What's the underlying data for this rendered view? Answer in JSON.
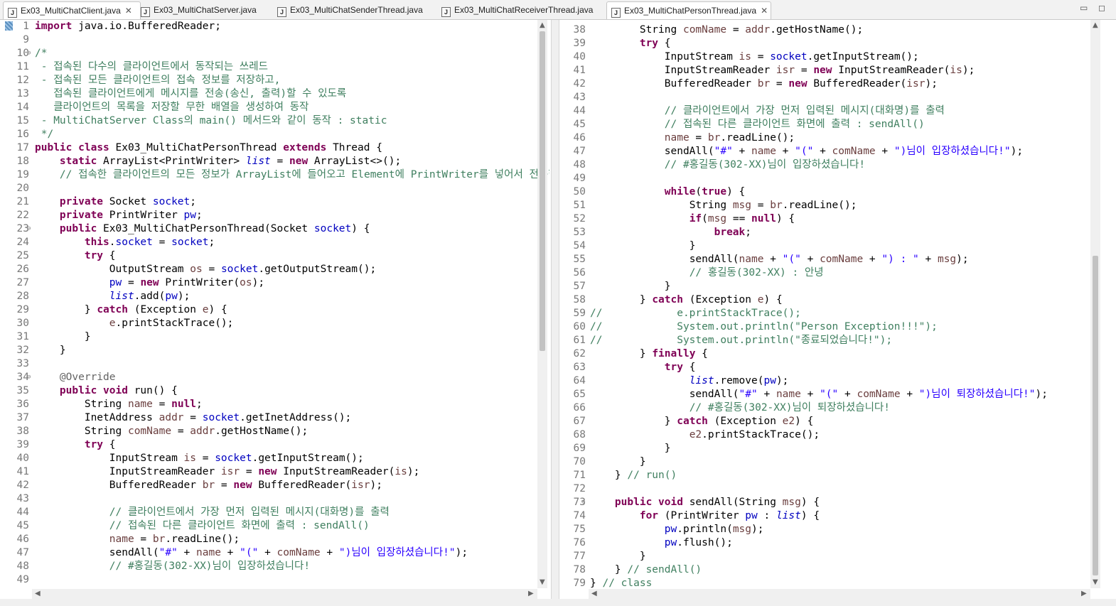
{
  "tabs": [
    {
      "label": "Ex03_MultiChatClient.java",
      "active": true,
      "closable": true
    },
    {
      "label": "Ex03_MultiChatServer.java",
      "active": false,
      "closable": false
    },
    {
      "label": "Ex03_MultiChatSenderThread.java",
      "active": false,
      "closable": false
    },
    {
      "label": "Ex03_MultiChatReceiverThread.java",
      "active": false,
      "closable": false
    },
    {
      "label": "Ex03_MultiChatPersonThread.java",
      "active": true,
      "closable": true
    }
  ],
  "icons": {
    "tab_file": "java-file-icon",
    "close": "close-icon",
    "minimize": "minimize-icon",
    "maximize": "maximize-icon"
  },
  "window_controls": {
    "minimize": "▭",
    "maximize": "◻"
  },
  "colors": {
    "keyword": "#7f0055",
    "comment": "#3f7f5f",
    "field": "#0000c0",
    "string": "#2a00ff",
    "local_var": "#6a3e3e",
    "line_number": "#787878"
  },
  "left_editor": {
    "line_numbers": [
      "1",
      "9",
      "10",
      "11",
      "12",
      "13",
      "14",
      "15",
      "16",
      "17",
      "18",
      "19",
      "20",
      "21",
      "22",
      "23",
      "24",
      "25",
      "26",
      "27",
      "28",
      "29",
      "30",
      "31",
      "32",
      "33",
      "34",
      "35",
      "36",
      "37",
      "38",
      "39",
      "40",
      "41",
      "42",
      "43",
      "44",
      "45",
      "46",
      "47",
      "48",
      "49"
    ],
    "lines": [
      "import java.io.BufferedReader;",
      "",
      "/*",
      " - 접속된 다수의 클라이언트에서 동작되는 쓰레드",
      " - 접속된 모든 클라이언트의 접속 정보를 저장하고,",
      "   접속된 클라이언트에게 메시지를 전송(송신, 출력)할 수 있도록",
      "   클라이언트의 목록을 저장할 무한 배열을 생성하여 동작",
      " - MultiChatServer Class의 main() 메서드와 같이 동작 : static",
      " */",
      "public class Ex03_MultiChatPersonThread extends Thread {",
      "    static ArrayList<PrintWriter> list = new ArrayList<>();",
      "    // 접속한 클라이언트의 모든 정보가 ArrayList에 들어오고 Element에 PrintWriter를 넣어서 전송한다",
      "",
      "    private Socket socket;",
      "    private PrintWriter pw;",
      "    public Ex03_MultiChatPersonThread(Socket socket) {",
      "        this.socket = socket;",
      "        try {",
      "            OutputStream os = socket.getOutputStream();",
      "            pw = new PrintWriter(os);",
      "            list.add(pw);",
      "        } catch (Exception e) {",
      "            e.printStackTrace();",
      "        }",
      "    }",
      "",
      "    @Override",
      "    public void run() {",
      "        String name = null;",
      "        InetAddress addr = socket.getInetAddress();",
      "        String comName = addr.getHostName();",
      "        try {",
      "            InputStream is = socket.getInputStream();",
      "            InputStreamReader isr = new InputStreamReader(is);",
      "            BufferedReader br = new BufferedReader(isr);",
      "",
      "            // 클라이언트에서 가장 먼저 입력된 메시지(대화명)를 출력",
      "            // 접속된 다른 클라이언트 화면에 출력 : sendAll()",
      "            name = br.readLine();",
      "            sendAll(\"#\" + name + \"(\" + comName + \")님이 입장하셨습니다!\");",
      "            // #홍길동(302-XX)님이 입장하셨습니다!",
      ""
    ]
  },
  "right_editor": {
    "line_numbers": [
      "38",
      "39",
      "40",
      "41",
      "42",
      "43",
      "44",
      "45",
      "46",
      "47",
      "48",
      "49",
      "50",
      "51",
      "52",
      "53",
      "54",
      "55",
      "56",
      "57",
      "58",
      "59",
      "60",
      "61",
      "62",
      "63",
      "64",
      "65",
      "66",
      "67",
      "68",
      "69",
      "70",
      "71",
      "72",
      "73",
      "74",
      "75",
      "76",
      "77",
      "78",
      "79"
    ],
    "lines": [
      "        String comName = addr.getHostName();",
      "        try {",
      "            InputStream is = socket.getInputStream();",
      "            InputStreamReader isr = new InputStreamReader(is);",
      "            BufferedReader br = new BufferedReader(isr);",
      "",
      "            // 클라이언트에서 가장 먼저 입력된 메시지(대화명)를 출력",
      "            // 접속된 다른 클라이언트 화면에 출력 : sendAll()",
      "            name = br.readLine();",
      "            sendAll(\"#\" + name + \"(\" + comName + \")님이 입장하셨습니다!\");",
      "            // #홍길동(302-XX)님이 입장하셨습니다!",
      "",
      "            while(true) {",
      "                String msg = br.readLine();",
      "                if(msg == null) {",
      "                    break;",
      "                }",
      "                sendAll(name + \"(\" + comName + \") : \" + msg);",
      "                // 홍길동(302-XX) : 안녕",
      "            }",
      "        } catch (Exception e) {",
      "//            e.printStackTrace();",
      "//            System.out.println(\"Person Exception!!!\");",
      "//            System.out.println(\"종료되었습니다!\");",
      "        } finally {",
      "            try {",
      "                list.remove(pw);",
      "                sendAll(\"#\" + name + \"(\" + comName + \")님이 퇴장하셨습니다!\");",
      "                // #홍길동(302-XX)님이 퇴장하셨습니다!",
      "            } catch (Exception e2) {",
      "                e2.printStackTrace();",
      "            }",
      "        }",
      "    } // run()",
      "",
      "    public void sendAll(String msg) {",
      "        for (PrintWriter pw : list) {",
      "            pw.println(msg);",
      "            pw.flush();",
      "        }",
      "    } // sendAll()",
      "} // class"
    ]
  },
  "scrollbars": {
    "left_vertical_position": 0.0,
    "right_vertical_position": 1.0
  }
}
